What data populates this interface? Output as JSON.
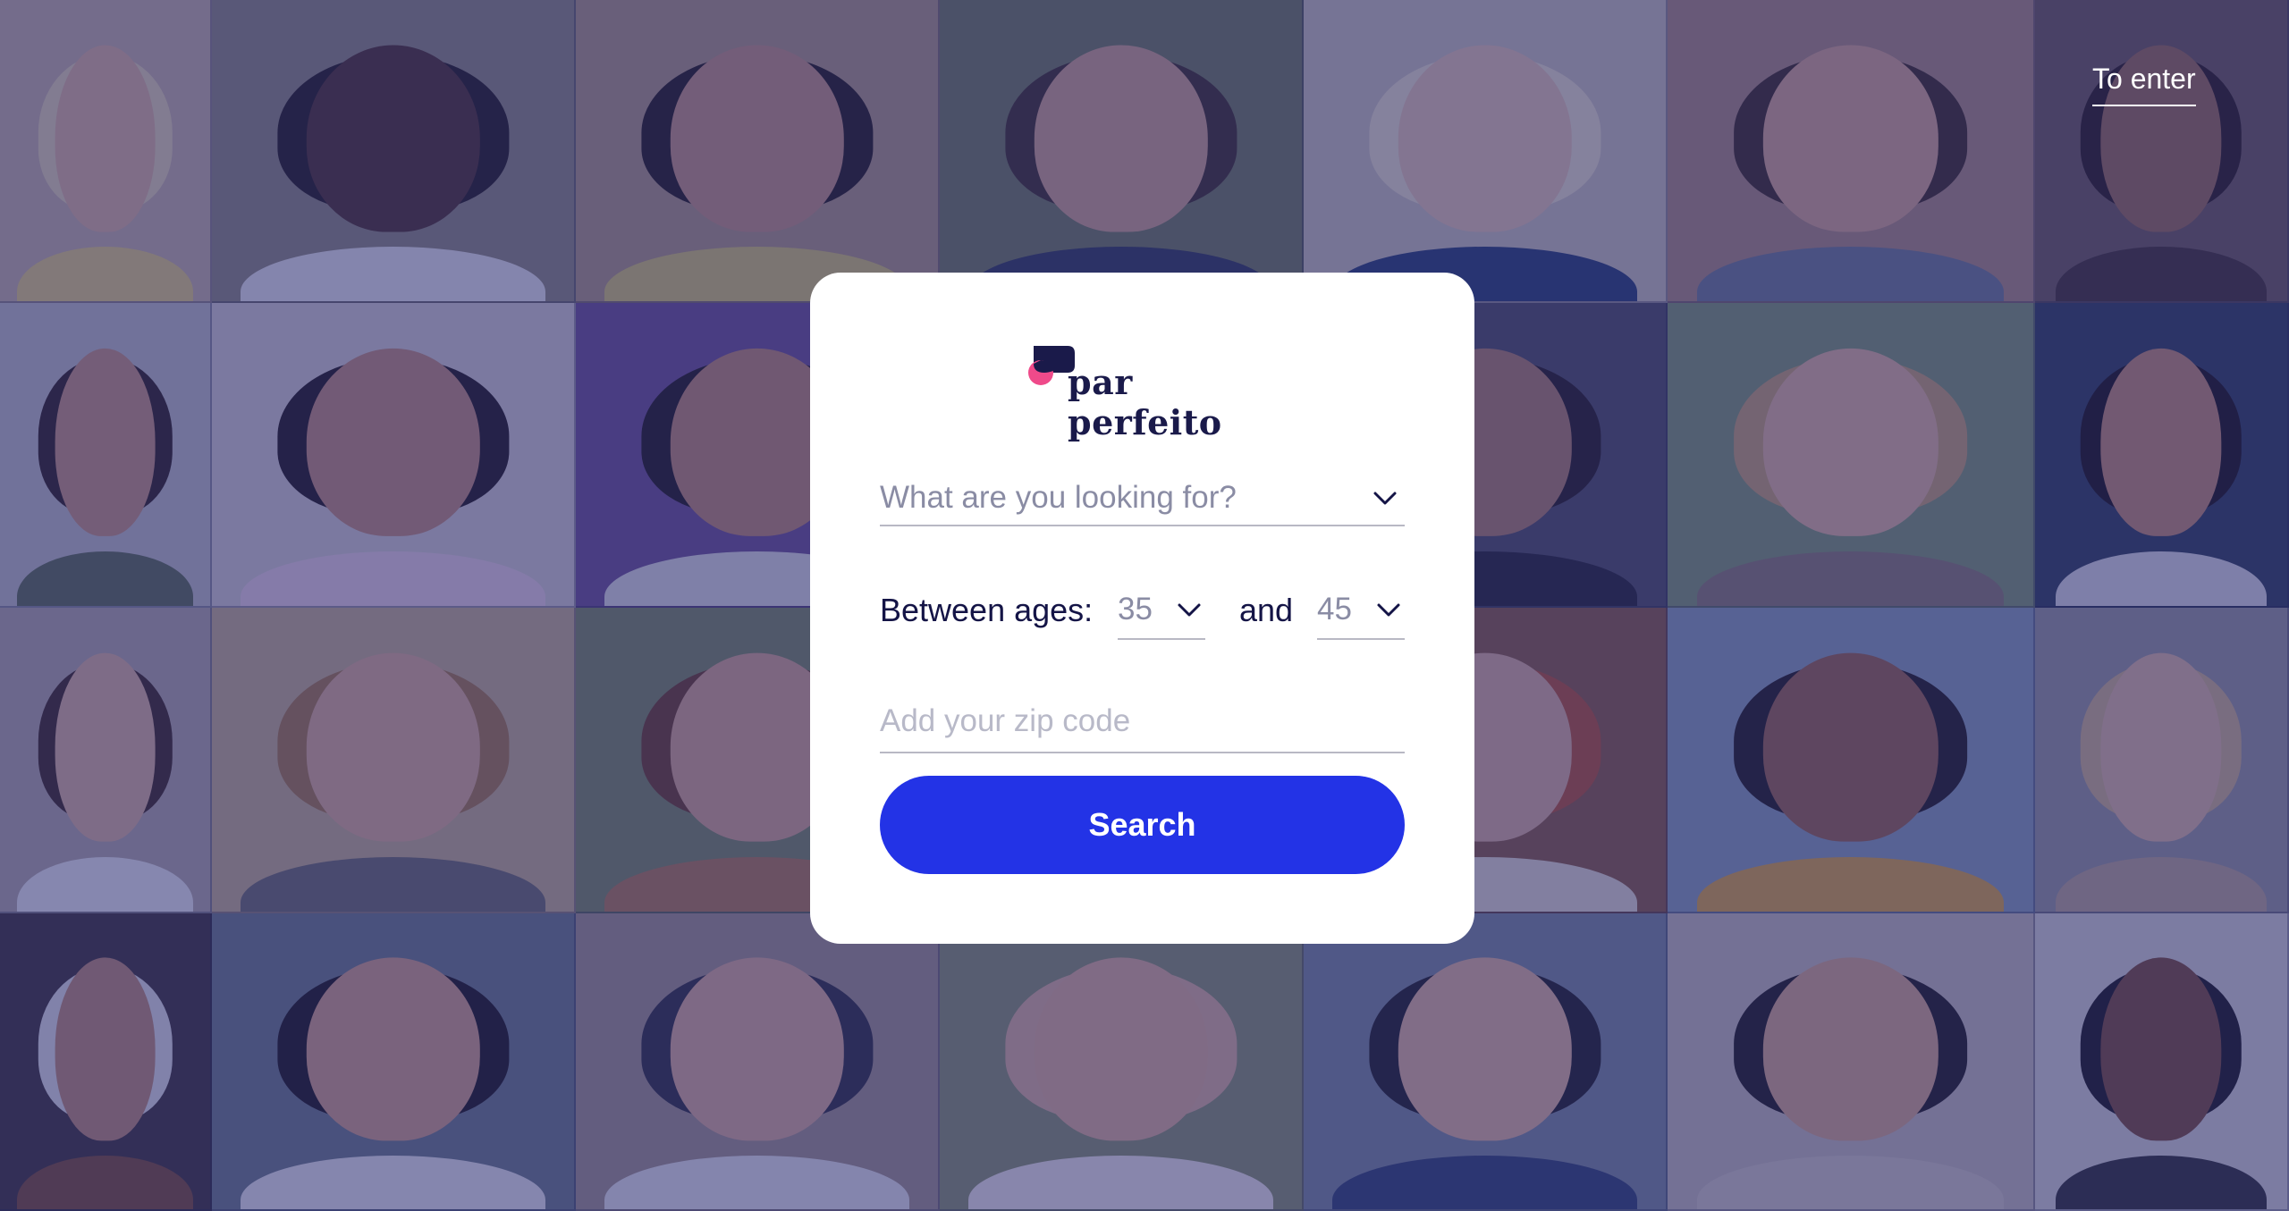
{
  "colors": {
    "overlay": "#2e3078",
    "card_background": "#ffffff",
    "brand_navy": "#1a1a4a",
    "brand_pink": "#ef4a8a",
    "button_blue": "#2333e6",
    "placeholder_gray": "#8a8ca4"
  },
  "header": {
    "enter_link": "To enter"
  },
  "background": {
    "description_icon": "profile-photo-grid"
  },
  "logo": {
    "icon": "speech-bubbles-icon",
    "text": "par perfeito"
  },
  "form": {
    "looking_for": {
      "value": "What are you looking for?",
      "icon": "chevron-down-icon"
    },
    "ages": {
      "label": "Between ages:",
      "min": "35",
      "connector": "and",
      "max": "45"
    },
    "zip": {
      "placeholder": "Add your zip code"
    },
    "search_button": "Search"
  }
}
